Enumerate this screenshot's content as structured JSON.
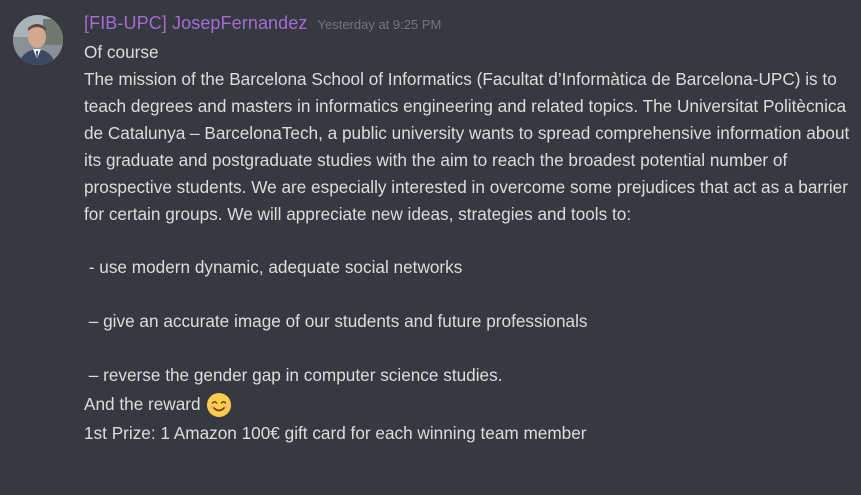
{
  "message": {
    "username": "[FIB-UPC] JosepFernandez",
    "timestamp": "Yesterday at 9:25 PM",
    "lines": {
      "l1": "Of course",
      "mission": "The mission of the Barcelona School of Informatics (Facultat d’Informàtica de Barcelona-UPC) is to teach degrees and masters in informatics engineering and related topics. The Universitat Politècnica de Catalunya – BarcelonaTech, a public university wants to spread comprehensive information about its graduate and postgraduate studies with the aim to reach the broadest potential number of prospective students. We are especially interested in overcome some prejudices that act as a barrier for certain groups. We will appreciate new ideas, strategies and tools to:",
      "bullet1": " - use modern dynamic, adequate social networks",
      "bullet2": " – give an accurate image of our students and future professionals",
      "bullet3": " – reverse the gender gap in computer science studies.",
      "reward": "And the reward",
      "prize": "1st Prize: 1 Amazon 100€ gift card for each winning team member"
    },
    "emoji": "smiling-face-with-smiling-eyes"
  },
  "colors": {
    "background": "#36393f",
    "username": "#a66bd4",
    "text": "#dcddde",
    "timestamp": "#72767d"
  }
}
